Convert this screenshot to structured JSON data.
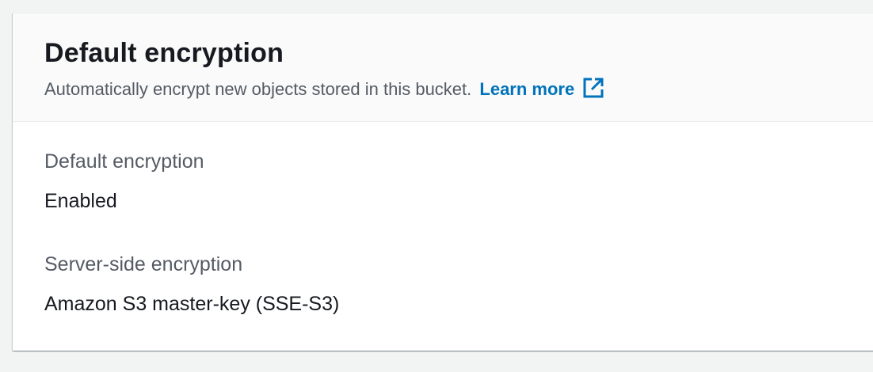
{
  "panel": {
    "title": "Default encryption",
    "description": "Automatically encrypt new objects stored in this bucket.",
    "learn_more_label": "Learn more",
    "learn_more_icon": "external-link-icon"
  },
  "fields": [
    {
      "label": "Default encryption",
      "value": "Enabled"
    },
    {
      "label": "Server-side encryption",
      "value": "Amazon S3 master-key (SSE-S3)"
    }
  ],
  "colors": {
    "link": "#0073bb",
    "title_text": "#16191f",
    "secondary_text": "#545b64",
    "header_bg": "#fafafa",
    "page_bg": "#f2f3f3"
  }
}
